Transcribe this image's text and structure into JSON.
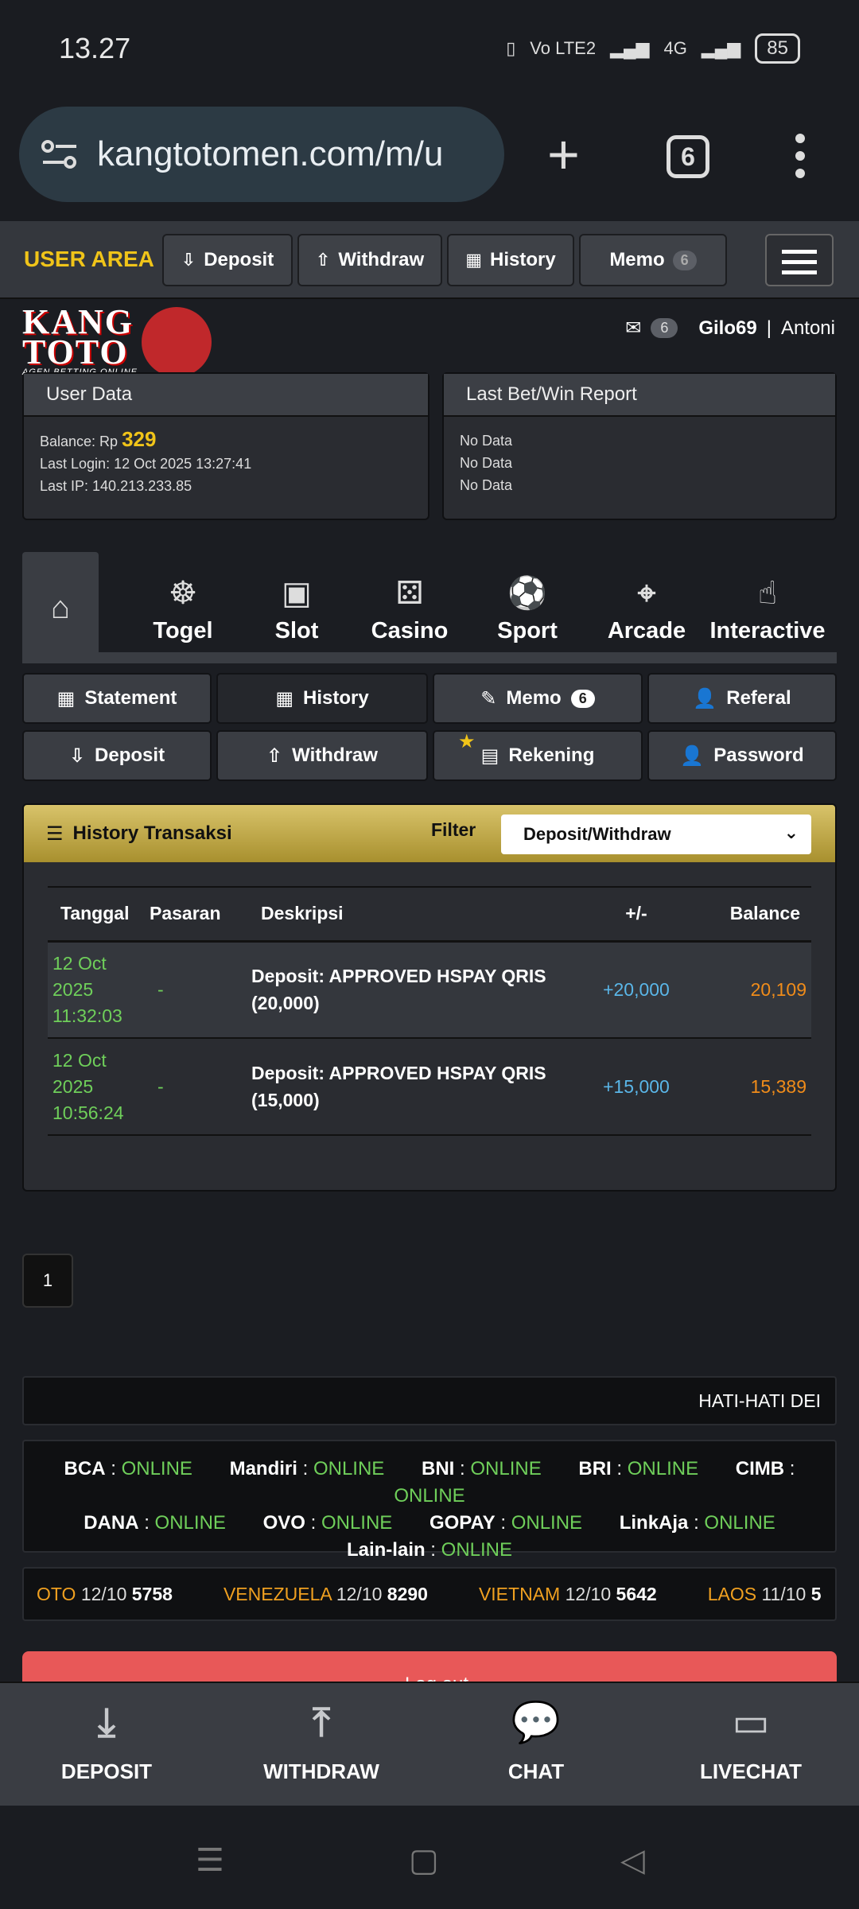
{
  "statusbar": {
    "time": "13.27",
    "network": "Vo LTE2",
    "net2": "4G",
    "battery": "85"
  },
  "browser": {
    "url": "kangtotomen.com/m/u",
    "tab_count": "6"
  },
  "topnav": {
    "user_area": "USER AREA",
    "deposit": "Deposit",
    "withdraw": "Withdraw",
    "history": "History",
    "memo": "Memo",
    "memo_count": "6"
  },
  "logo": {
    "line1a": "KANG",
    "line1b": "TOTO",
    "tagline": "AGEN BETTING ONLINE"
  },
  "user": {
    "mail_count": "6",
    "username": "Gilo69",
    "name": "Antoni"
  },
  "user_data": {
    "title": "User Data",
    "balance_label": "Balance: Rp ",
    "balance": "329",
    "last_login": "Last Login: 12 Oct 2025 13:27:41",
    "last_ip": "Last IP: 140.213.233.85"
  },
  "last_bet": {
    "title": "Last Bet/Win Report",
    "rows": [
      "No Data",
      "No Data",
      "No Data"
    ]
  },
  "game_tabs": [
    "Togel",
    "Slot",
    "Casino",
    "Sport",
    "Arcade",
    "Interactive"
  ],
  "sub_buttons": {
    "statement": "Statement",
    "history": "History",
    "memo": "Memo",
    "memo_count": "6",
    "referal": "Referal",
    "deposit": "Deposit",
    "withdraw": "Withdraw",
    "rekening": "Rekening",
    "password": "Password"
  },
  "history": {
    "title": "History Transaksi",
    "filter_label": "Filter",
    "filter_value": "Deposit/Withdraw",
    "columns": [
      "Tanggal",
      "Pasaran",
      "Deskripsi",
      "+/-",
      "Balance"
    ],
    "rows": [
      {
        "date1": "12 Oct",
        "date2": "2025",
        "date3": "11:32:03",
        "pasaran": "-",
        "desc1": "Deposit: APPROVED HSPAY QRIS",
        "desc2": "(20,000)",
        "amount": "+20,000",
        "balance": "20,109"
      },
      {
        "date1": "12 Oct",
        "date2": "2025",
        "date3": "10:56:24",
        "pasaran": "-",
        "desc1": "Deposit: APPROVED HSPAY QRIS",
        "desc2": "(15,000)",
        "amount": "+15,000",
        "balance": "15,389"
      }
    ]
  },
  "pager": {
    "page": "1"
  },
  "marquee": "HATI-HATI DEI",
  "banks": {
    "status": "ONLINE",
    "row1": [
      "BCA",
      "Mandiri",
      "BNI",
      "BRI",
      "CIMB"
    ],
    "row2": [
      "DANA",
      "OVO",
      "GOPAY",
      "LinkAja"
    ],
    "row3": [
      "Lain-lain"
    ]
  },
  "results": [
    {
      "market": "OTO",
      "date": "12/10",
      "number": "5758"
    },
    {
      "market": "VENEZUELA",
      "date": "12/10",
      "number": "8290"
    },
    {
      "market": "VIETNAM",
      "date": "12/10",
      "number": "5642"
    },
    {
      "market": "LAOS",
      "date": "11/10",
      "number": "5"
    }
  ],
  "logout": "Log out",
  "bottom_bar": [
    "DEPOSIT",
    "WITHDRAW",
    "CHAT",
    "LIVECHAT"
  ],
  "colors": {
    "accent": "#f0c419",
    "online": "#6fcf5a",
    "amount": "#5ab6e8",
    "balance": "#f08c1a",
    "logout": "#e85858"
  }
}
